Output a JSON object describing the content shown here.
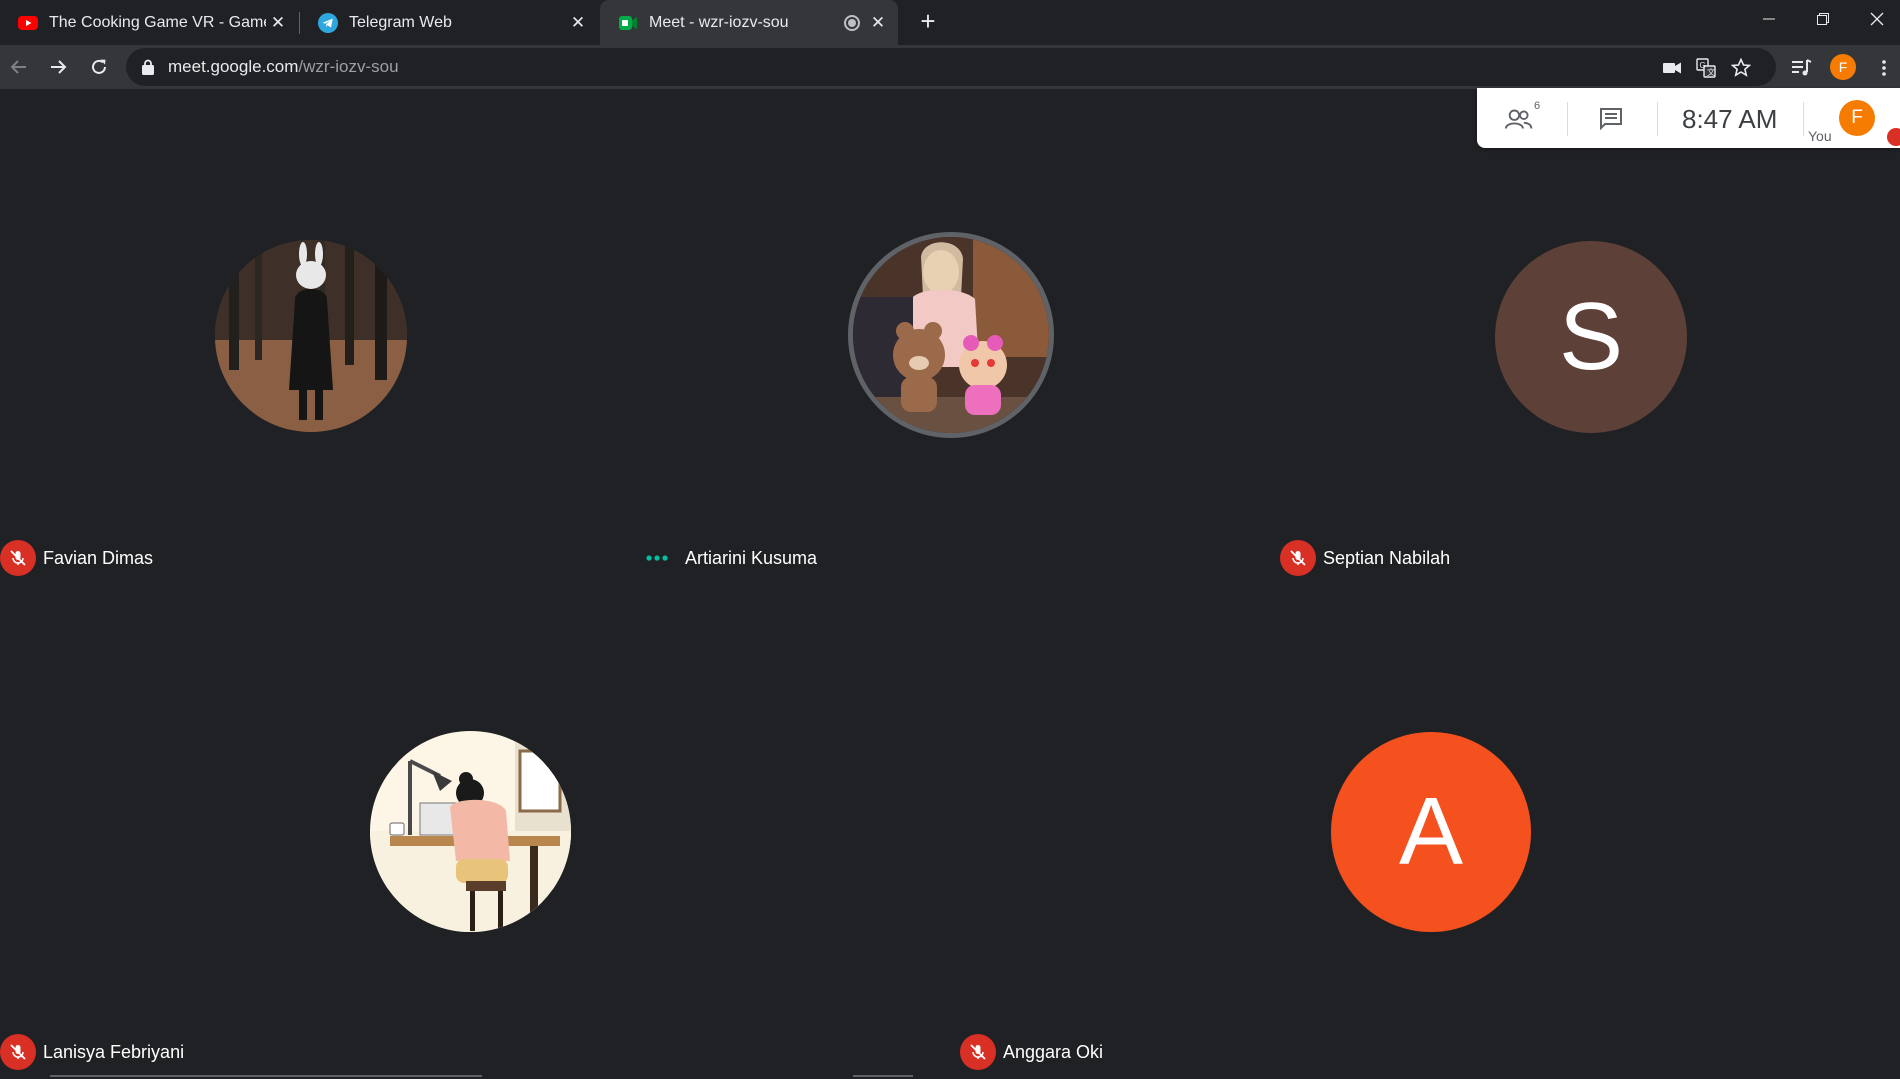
{
  "browser": {
    "tabs": [
      {
        "title": "The Cooking Game VR - Gameplay",
        "icon": "youtube-icon",
        "active": false
      },
      {
        "title": "Telegram Web",
        "icon": "telegram-icon",
        "active": false
      },
      {
        "title": "Meet - wzr-iozv-sou",
        "icon": "google-meet-icon",
        "active": true
      }
    ],
    "url_host": "meet.google.com",
    "url_path": "/wzr-iozv-sou",
    "profile_initial": "F"
  },
  "meet": {
    "participant_count": "6",
    "time": "8:47  AM",
    "self_label": "You",
    "self_initial": "F",
    "participants": [
      {
        "name": "Favian Dimas",
        "status": "muted",
        "avatar": "photo"
      },
      {
        "name": "Artiarini Kusuma",
        "status": "speaking",
        "avatar": "photo"
      },
      {
        "name": "Septian Nabilah",
        "status": "muted",
        "avatar": "letter",
        "initial": "S",
        "color": "#5d4037"
      },
      {
        "name": "Lanisya Febriyani",
        "status": "muted",
        "avatar": "illustration"
      },
      {
        "name": "Anggara Oki",
        "status": "muted",
        "avatar": "letter",
        "initial": "A",
        "color": "#f4511e"
      }
    ]
  },
  "colors": {
    "background": "#202124",
    "mute_red": "#d93025",
    "speaking_teal": "#00bfa5",
    "profile_orange": "#f57c00"
  }
}
